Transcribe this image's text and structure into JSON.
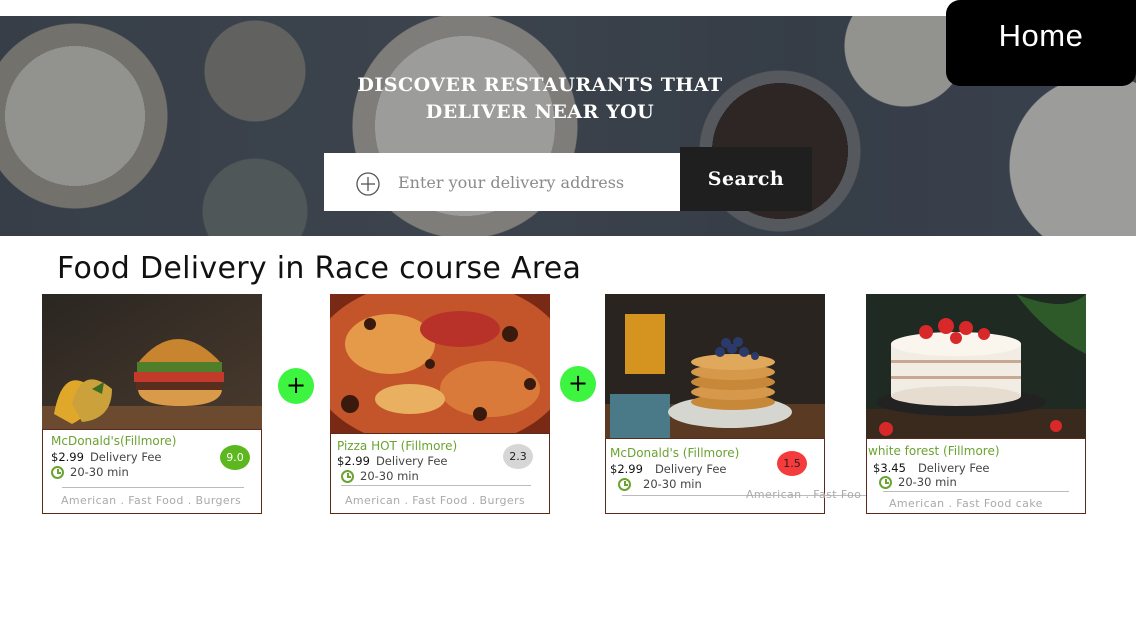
{
  "nav": {
    "home_label": "Home"
  },
  "hero": {
    "title_line1": "DISCOVER RESTAURANTS THAT",
    "title_line2": "DELIVER NEAR YOU",
    "search_placeholder": "Enter your delivery address",
    "search_button": "Search"
  },
  "section_title": "Food Delivery in Race course Area",
  "restaurants": [
    {
      "name": "McDonald's(Fillmore)",
      "price": "$2.99",
      "fee_label": "Delivery Fee",
      "time": "20-30 min",
      "tags": "American . Fast Food . Burgers",
      "rating": "9.0",
      "rating_color": "#5cb81e"
    },
    {
      "name": "Pizza HOT   (Fillmore)",
      "price": "$2.99",
      "fee_label": "Delivery Fee",
      "time": "20-30 min",
      "tags": "American . Fast Food . Burgers",
      "rating": "2.3",
      "rating_color": "#d6d6d6"
    },
    {
      "name": "McDonald's  (Fillmore)",
      "price": "$2.99",
      "fee_label": "Delivery Fee",
      "time": "20-30 min",
      "tags": "American . Fast Foo",
      "rating": "1.5",
      "rating_color": "#f53b3b"
    },
    {
      "name": "white forest  (Fillmore)",
      "price": "$3.45",
      "fee_label": "Delivery Fee",
      "time": "20-30 min",
      "tags": "American . Fast Food  cake"
    }
  ],
  "add_buttons": [
    "+",
    "+"
  ],
  "colors": {
    "accent_green": "#6aa332",
    "add_button": "#3df540",
    "dark": "#1f1f1f"
  },
  "icons": [
    "locate-icon",
    "clock-icon"
  ]
}
